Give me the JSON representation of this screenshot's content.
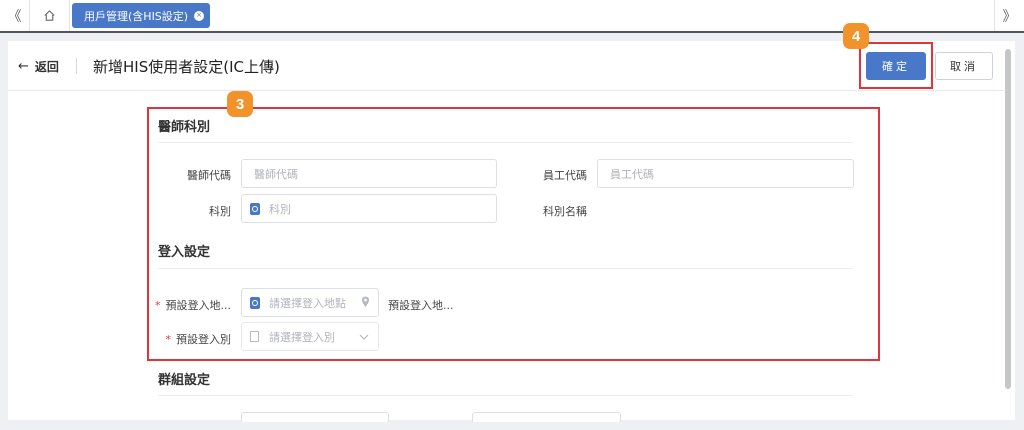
{
  "topbar": {
    "nav_left": "《",
    "nav_right": "》",
    "active_tab": "用戶管理(含HIS設定)",
    "tab_close": "×"
  },
  "header": {
    "back_label": "返回",
    "title": "新增HIS使用者設定(IC上傳)",
    "confirm_label": "確定",
    "cancel_label": "取消"
  },
  "sections": {
    "doctor": {
      "title": "醫師科別",
      "doctor_code_label": "醫師代碼",
      "doctor_code_placeholder": "醫師代碼",
      "employee_code_label": "員工代碼",
      "employee_code_placeholder": "員工代碼",
      "dept_label": "科別",
      "dept_placeholder": "科別",
      "dept_name_label": "科別名稱"
    },
    "login": {
      "title": "登入設定",
      "location_label": "預設登入地...",
      "location_placeholder": "請選擇登入地點",
      "location_name_label": "預設登入地...",
      "type_label": "預設登入別",
      "type_placeholder": "請選擇登入別"
    },
    "group": {
      "title": "群組設定"
    }
  },
  "annotations": {
    "badge_3": "3",
    "badge_4": "4"
  },
  "colors": {
    "accent": "#4a78c8",
    "highlight": "#e0333a",
    "badge": "#f2922a"
  }
}
